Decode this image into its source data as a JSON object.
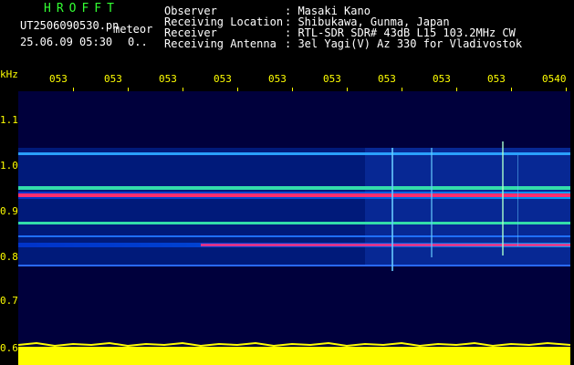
{
  "header": {
    "program": "HROFFT",
    "filename": "UT2506090530.pn",
    "meteor_label": "meteor",
    "datetime": "25.06.09 05:30",
    "count": "0..",
    "fields": [
      {
        "label": "Observer",
        "value": ": Masaki Kano"
      },
      {
        "label": "Receiving Location",
        "value": ": Shibukawa, Gunma, Japan"
      },
      {
        "label": "Receiver",
        "value": ": RTL-SDR SDR# 43dB L15 103.2MHz CW"
      },
      {
        "label": "Receiving Antenna",
        "value": ": 3el Yagi(V) Az 330 for Vladivostok"
      }
    ]
  },
  "axes": {
    "y_unit": "kHz",
    "y_ticks": [
      "1.1",
      "1.0",
      "0.9",
      "0.8",
      "0.7",
      "0.6"
    ],
    "x_ticks": [
      "053",
      "053",
      "053",
      "053",
      "053",
      "053",
      "053",
      "053",
      "053",
      "0540"
    ]
  },
  "colors": {
    "background": "#000000",
    "plot_bg": "#00003c",
    "accent": "#ffff00",
    "title": "#33ff33"
  }
}
